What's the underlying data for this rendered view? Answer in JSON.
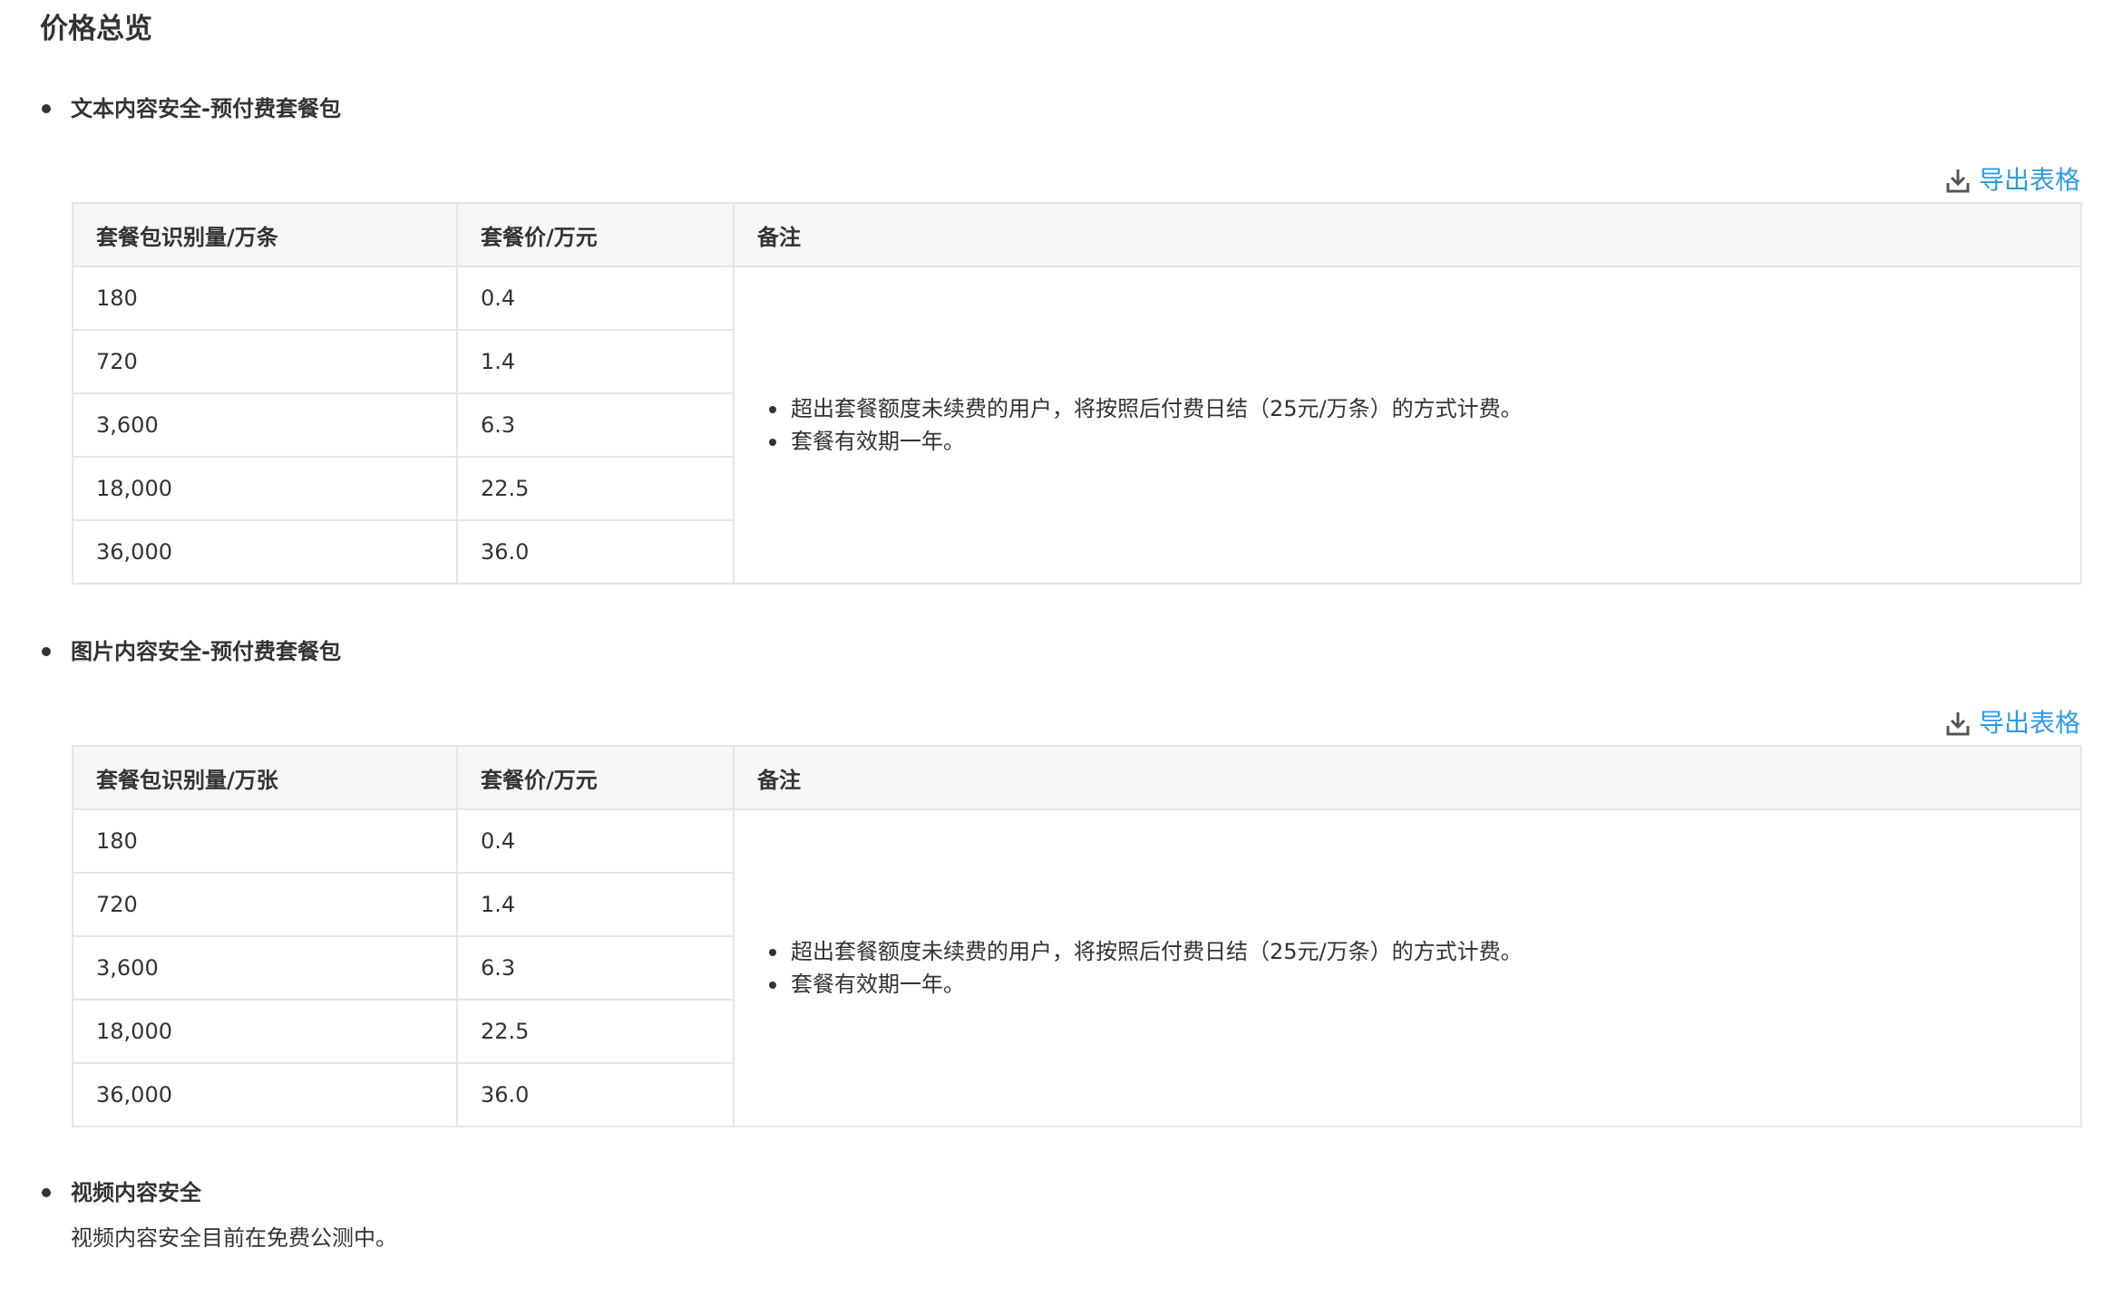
{
  "page": {
    "title": "价格总览"
  },
  "colors": {
    "link": "#2f9be6",
    "header_bg": "#f5f7f9",
    "border": "#e3e6ea",
    "text": "#333333"
  },
  "sections": [
    {
      "title": "文本内容安全-预付费套餐包",
      "export_label": "导出表格",
      "export_icon": "download-icon",
      "table": {
        "headers": [
          "套餐包识别量/万条",
          "套餐价/万元",
          "备注"
        ],
        "rows": [
          [
            "180",
            "0.4"
          ],
          [
            "720",
            "1.4"
          ],
          [
            "3,600",
            "6.3"
          ],
          [
            "18,000",
            "22.5"
          ],
          [
            "36,000",
            "36.0"
          ]
        ],
        "notes": [
          "超出套餐额度未续费的用户，将按照后付费日结（25元/万条）的方式计费。",
          "套餐有效期一年。"
        ]
      }
    },
    {
      "title": "图片内容安全-预付费套餐包",
      "export_label": "导出表格",
      "export_icon": "download-icon",
      "table": {
        "headers": [
          "套餐包识别量/万张",
          "套餐价/万元",
          "备注"
        ],
        "rows": [
          [
            "180",
            "0.4"
          ],
          [
            "720",
            "1.4"
          ],
          [
            "3,600",
            "6.3"
          ],
          [
            "18,000",
            "22.5"
          ],
          [
            "36,000",
            "36.0"
          ]
        ],
        "notes": [
          "超出套餐额度未续费的用户，将按照后付费日结（25元/万条）的方式计费。",
          "套餐有效期一年。"
        ]
      }
    },
    {
      "title": "视频内容安全",
      "description": "视频内容安全目前在免费公测中。"
    }
  ]
}
